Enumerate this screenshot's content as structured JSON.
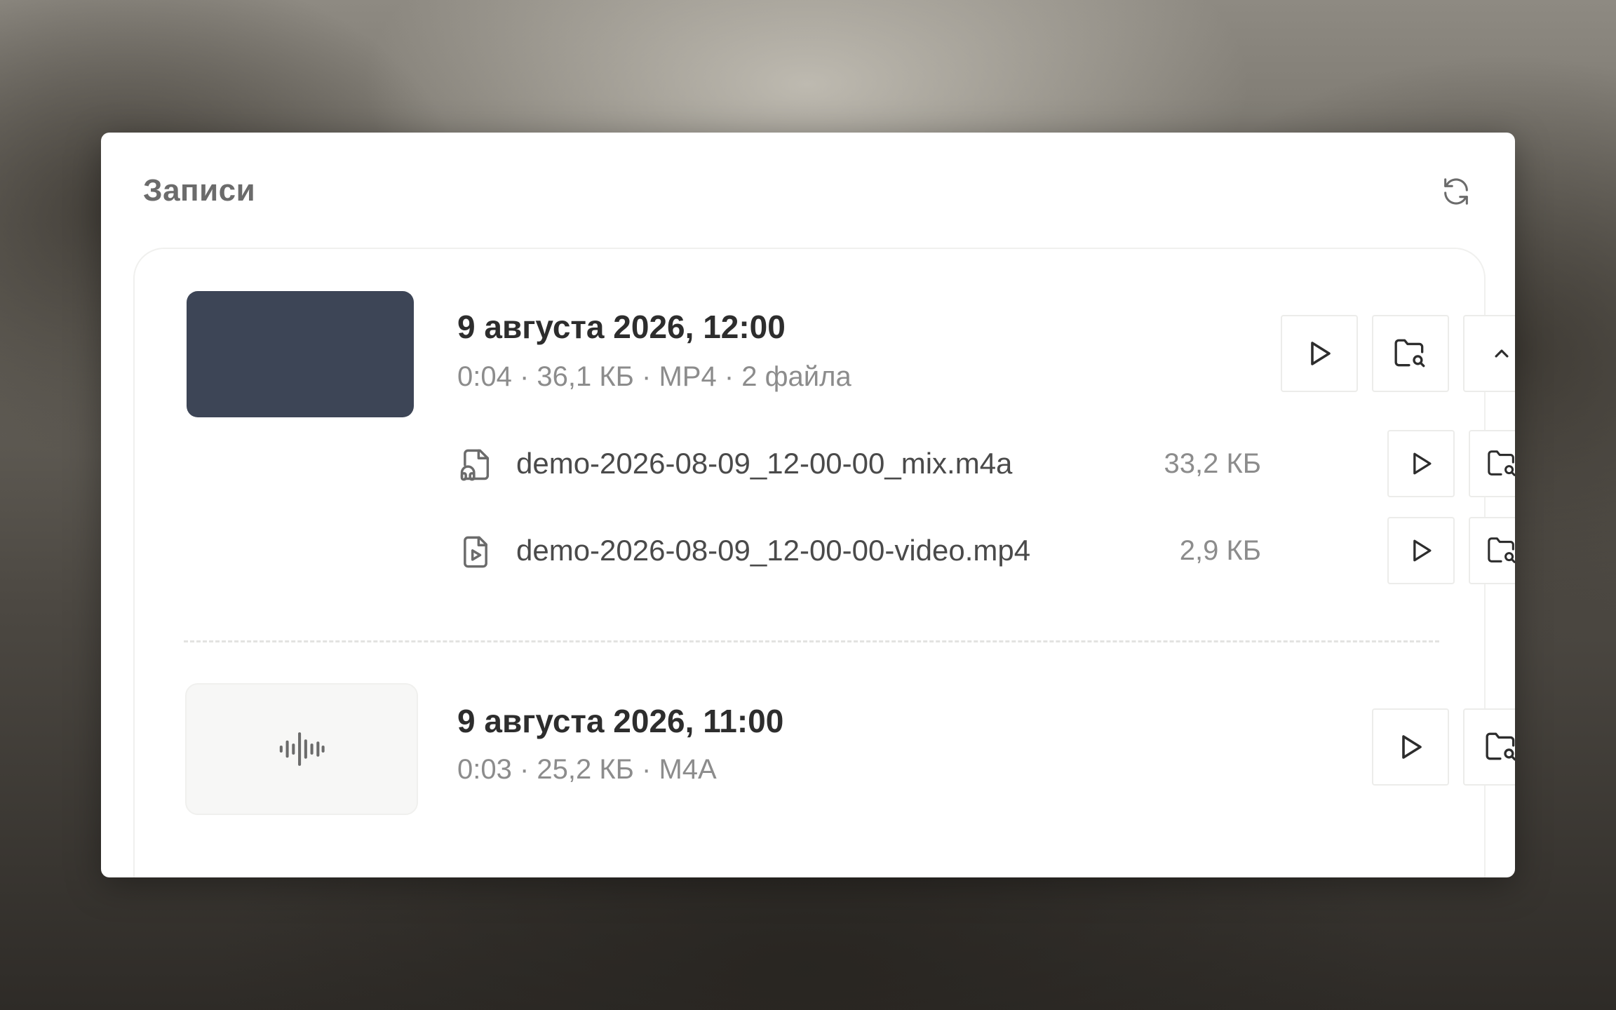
{
  "panel": {
    "title": "Записи"
  },
  "recordings": [
    {
      "title": "9 августа 2026, 12:00",
      "meta": "0:04 · 36,1 КБ · MP4 · 2 файла",
      "thumbnail": "video",
      "expanded": true,
      "files": [
        {
          "name": "demo-2026-08-09_12-00-00_mix.m4a",
          "size": "33,2 КБ",
          "icon": "audio-file-icon"
        },
        {
          "name": "demo-2026-08-09_12-00-00-video.mp4",
          "size": "2,9 КБ",
          "icon": "video-file-icon"
        }
      ]
    },
    {
      "title": "9 августа 2026, 11:00",
      "meta": "0:03 · 25,2 КБ · M4A",
      "thumbnail": "audio",
      "expanded": false
    }
  ],
  "colors": {
    "video_thumb": "#3d4556",
    "title_text": "#2d2d2d",
    "meta_text": "#8c8c8c"
  }
}
